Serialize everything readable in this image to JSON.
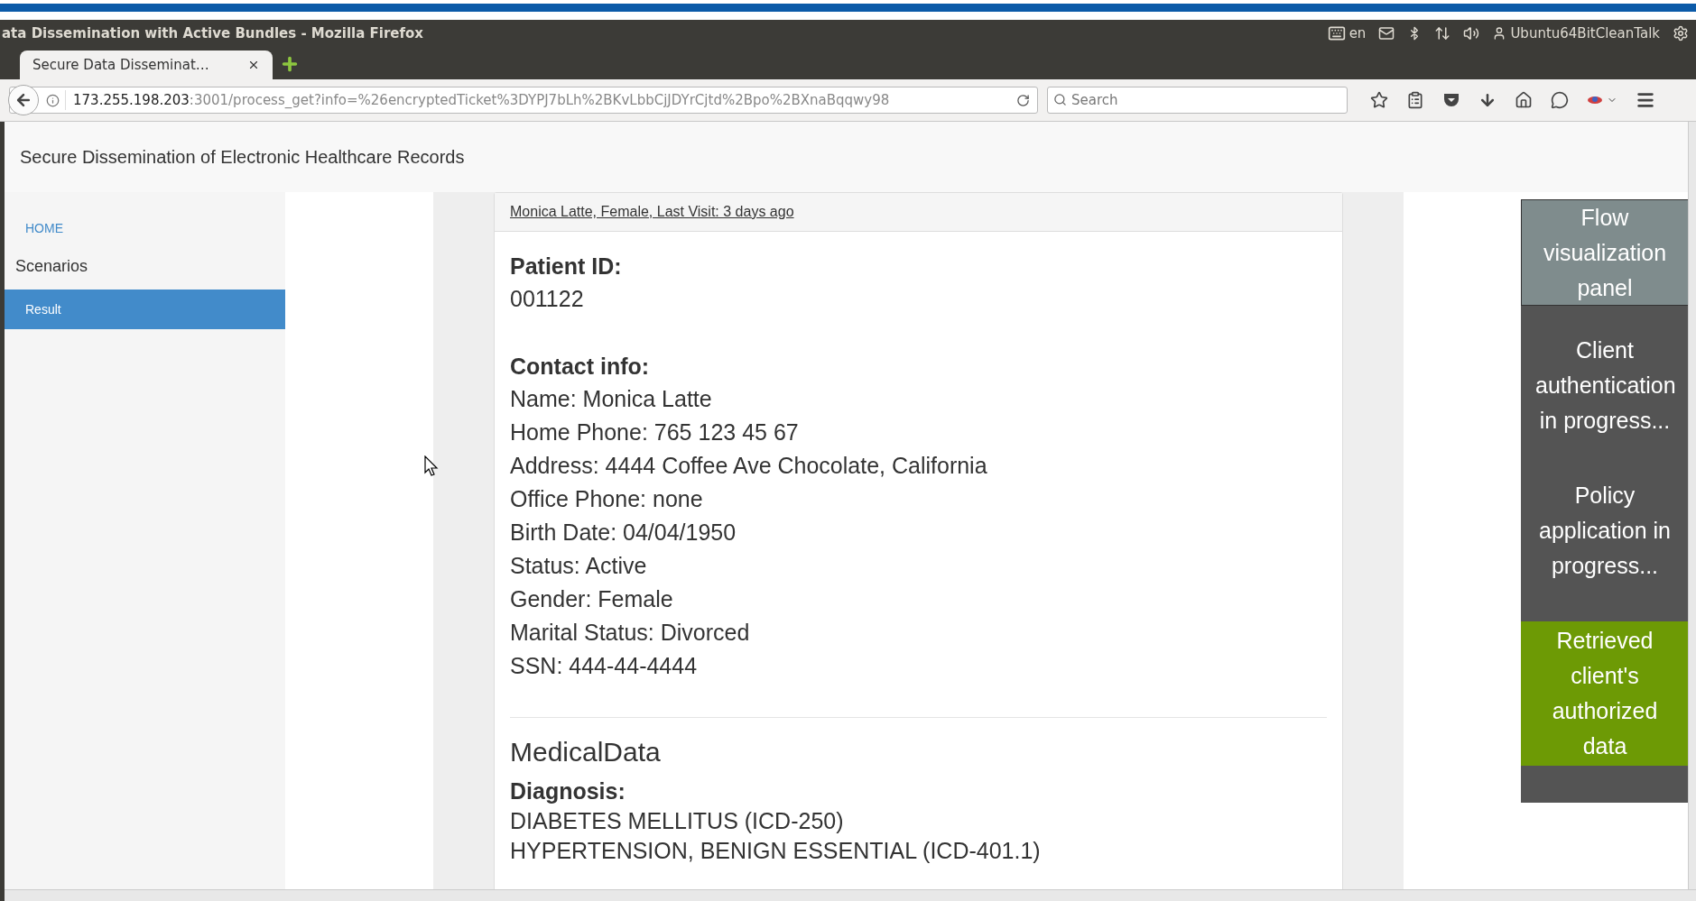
{
  "window": {
    "title": "ata Dissemination with Active Bundles - Mozilla Firefox"
  },
  "system_tray": {
    "keyboard_layout": "en",
    "user": "Ubuntu64BitCleanTalk"
  },
  "tabs": [
    {
      "label": "Secure Data Disseminat…",
      "selected": true
    }
  ],
  "address_bar": {
    "host": "173.255.198.203",
    "path": ":3001/process_get?info=%26encryptedTicket%3DYPJ7bLh%2BKvLbbCjJDYrCjtd%2Bpo%2BXnaBqqwy98"
  },
  "search": {
    "placeholder": "Search"
  },
  "header": {
    "title": "Secure Dissemination of Electronic Healthcare Records"
  },
  "sidebar": {
    "home_link": "HOME",
    "heading": "Scenarios",
    "items": [
      {
        "label": "Result",
        "selected": true
      }
    ]
  },
  "record": {
    "summary": "Monica Latte, Female, Last Visit: 3 days ago",
    "sections": [
      {
        "label": "Patient ID:",
        "lines": [
          "001122"
        ]
      },
      {
        "label": "Contact info:",
        "lines": [
          "Name: Monica Latte",
          "Home Phone: 765 123 45 67",
          "Address: 4444 Coffee Ave Chocolate, California",
          "Office Phone: none",
          "Birth Date: 04/04/1950",
          "Status: Active",
          "Gender: Female",
          "Marital Status: Divorced",
          "SSN: 444-44-4444"
        ]
      }
    ],
    "medical_heading": "MedicalData",
    "medical_sections": [
      {
        "label": "Diagnosis:",
        "lines": [
          "DIABETES MELLITUS (ICD-250)",
          "HYPERTENSION, BENIGN ESSENTIAL (ICD-401.1)"
        ]
      }
    ]
  },
  "flow_panel": {
    "title": "Flow visualization panel",
    "steps": [
      {
        "label": "Client authentication in progress...",
        "color": "#545454"
      },
      {
        "label": "Policy application in progress...",
        "color": "#545454"
      },
      {
        "label": "Retrieved client's authorized data",
        "color": "#6d9a05"
      }
    ]
  }
}
